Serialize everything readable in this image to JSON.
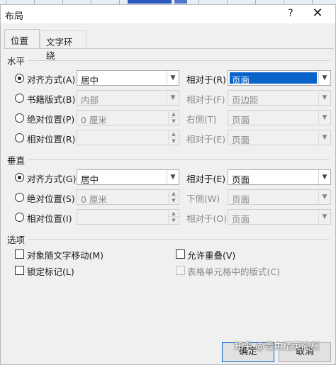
{
  "dialog": {
    "title": "布局",
    "help_glyph": "?",
    "close_glyph": "✕"
  },
  "tabs": [
    {
      "label": "位置"
    },
    {
      "label": "文字环绕"
    }
  ],
  "horizontal": {
    "heading": "水平",
    "rows": [
      {
        "label": "对齐方式(A)",
        "value": "居中",
        "rel_label": "相对于(R)",
        "rel_value": "页面",
        "checked": true,
        "rel_selected": true
      },
      {
        "label": "书籍版式(B)",
        "value": "内部",
        "rel_label": "相对于(F)",
        "rel_value": "页边距",
        "checked": false
      },
      {
        "label": "绝对位置(P)",
        "value": "0 厘米",
        "rel_label": "右侧(T)",
        "rel_value": "页面",
        "checked": false
      },
      {
        "label": "相对位置(R)",
        "value": "",
        "rel_label": "相对于(E)",
        "rel_value": "页面",
        "checked": false
      }
    ]
  },
  "vertical": {
    "heading": "垂直",
    "rows": [
      {
        "label": "对齐方式(G)",
        "value": "居中",
        "rel_label": "相对于(E)",
        "rel_value": "页面",
        "checked": true
      },
      {
        "label": "绝对位置(S)",
        "value": "0 厘米",
        "rel_label": "下侧(W)",
        "rel_value": "页面",
        "checked": false
      },
      {
        "label": "相对位置(I)",
        "value": "",
        "rel_label": "相对于(O)",
        "rel_value": "页面",
        "checked": false
      }
    ]
  },
  "options": {
    "heading": "选项",
    "items": [
      {
        "label": "对象随文字移动(M)",
        "checked": false,
        "enabled": true
      },
      {
        "label": "允许重叠(V)",
        "checked": true,
        "enabled": true
      },
      {
        "label": "锁定标记(L)",
        "checked": false,
        "enabled": true
      },
      {
        "label": "表格单元格中的版式(C)",
        "checked": true,
        "enabled": false
      }
    ]
  },
  "buttons": {
    "ok": "确定",
    "cancel": "取消"
  },
  "watermark": "知乎 @青虫精英陀根"
}
